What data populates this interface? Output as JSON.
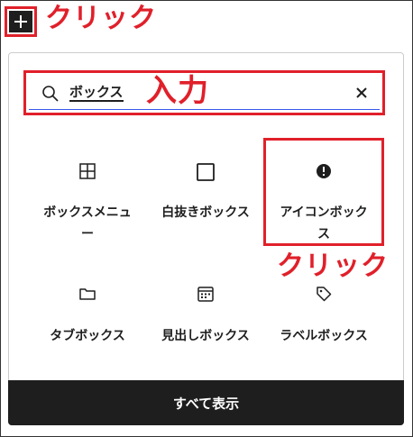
{
  "annotations": {
    "click_top": "クリック",
    "input": "入力",
    "click_item": "クリック"
  },
  "search": {
    "value": "ボックス"
  },
  "blocks": [
    {
      "label": "ボックスメニュー",
      "icon": "grid-icon"
    },
    {
      "label": "白抜きボックス",
      "icon": "square-outline-icon"
    },
    {
      "label": "アイコンボックス",
      "icon": "alert-circle-icon"
    },
    {
      "label": "タブボックス",
      "icon": "folder-icon"
    },
    {
      "label": "見出しボックス",
      "icon": "calendar-icon"
    },
    {
      "label": "ラベルボックス",
      "icon": "tag-icon"
    }
  ],
  "footer": {
    "show_all_label": "すべて表示"
  },
  "colors": {
    "annotation_red": "#e0202a",
    "dark": "#1e1e1e",
    "focus_blue": "#3858e9"
  }
}
